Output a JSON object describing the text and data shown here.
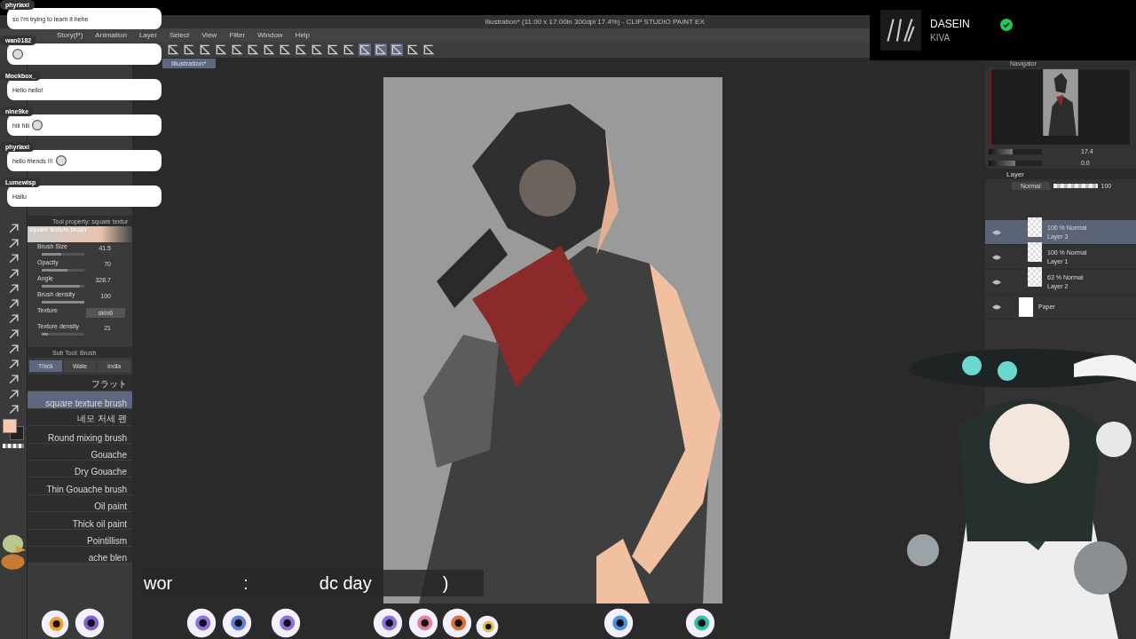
{
  "window": {
    "title": "Illustration* (11.00 x 17.00in 300dpi 17.4%) - CLIP STUDIO PAINT EX"
  },
  "menu": [
    "Story(P)",
    "Animation",
    "Layer",
    "Select",
    "View",
    "Filter",
    "Window",
    "Help"
  ],
  "canvas_tab": {
    "label": "Illustration*",
    "selected": true
  },
  "tool_property": {
    "title": "Tool property: square textur",
    "brush_name": "square texture brush",
    "rows": [
      {
        "label": "Brush Size",
        "value": "41.5",
        "level": 0.45
      },
      {
        "label": "Opacity",
        "value": "70",
        "level": 0.6
      },
      {
        "label": "Angle",
        "value": "328.7",
        "level": 0.9
      },
      {
        "label": "Brush density",
        "value": "100",
        "level": 1.0
      }
    ],
    "texture": {
      "label": "Texture",
      "value": "skin6"
    },
    "texture_density": {
      "label": "Texture density",
      "value": "21",
      "level": 0.15
    }
  },
  "sub_tool": {
    "title": "Sub Tool: Brush",
    "tabs": [
      {
        "label": "Thick",
        "selected": true
      },
      {
        "label": "Wate",
        "selected": false
      },
      {
        "label": "India",
        "selected": false
      }
    ],
    "brushes": [
      {
        "name": "フラット",
        "selected": false
      },
      {
        "name": "square texture brush",
        "selected": true
      },
      {
        "name": "네모 저세 펜",
        "selected": false
      },
      {
        "name": "Round mixing brush",
        "selected": false
      },
      {
        "name": "Gouache",
        "selected": false
      },
      {
        "name": "Dry Gouache",
        "selected": false
      },
      {
        "name": "Thin Gouache brush",
        "selected": false
      },
      {
        "name": "Oil paint",
        "selected": false
      },
      {
        "name": "Thick oil paint",
        "selected": false
      },
      {
        "name": "Pointillism",
        "selected": false
      },
      {
        "name": "ache blen",
        "selected": false
      }
    ]
  },
  "navigator": {
    "title": "Navigator",
    "zoom": "17.4",
    "rotation": "0.0",
    "zoom_slider": {
      "level": 0.45
    },
    "rotation_slider": {
      "level": 0.5
    }
  },
  "layer_panel": {
    "tab": "Layer",
    "blend_mode": "Normal",
    "opacity": "100",
    "opacity_slider": {
      "level": 1.0
    },
    "layers": [
      {
        "mode": "100 % Normal",
        "name": "Layer 3",
        "selected": true,
        "kind": "raster"
      },
      {
        "mode": "100 % Normal",
        "name": "Layer 1",
        "selected": false,
        "kind": "raster"
      },
      {
        "mode": "63 % Normal",
        "name": "Layer 2",
        "selected": false,
        "kind": "raster"
      },
      {
        "name": "Paper",
        "selected": false,
        "kind": "paper"
      }
    ]
  },
  "chat": [
    {
      "user": "phyriaxi",
      "text": "so i'm trying to learn it hehe",
      "emote": false
    },
    {
      "user": "wan0182",
      "emote": true
    },
    {
      "user": "Mockbox_",
      "text": "Hello hello!",
      "emote": false
    },
    {
      "user": "nine9ke",
      "text": "hiii hiii",
      "emote": true
    },
    {
      "user": "phyriaxi",
      "text": "hello friends !!!",
      "emote": true
    },
    {
      "user": "Lumewisp",
      "text": "Hallu",
      "emote": false
    }
  ],
  "now_playing": {
    "title": "DASEIN",
    "artist": "KIVA",
    "verified": true
  },
  "subtitle": [
    "wor",
    ":",
    "dc day",
    ")"
  ]
}
